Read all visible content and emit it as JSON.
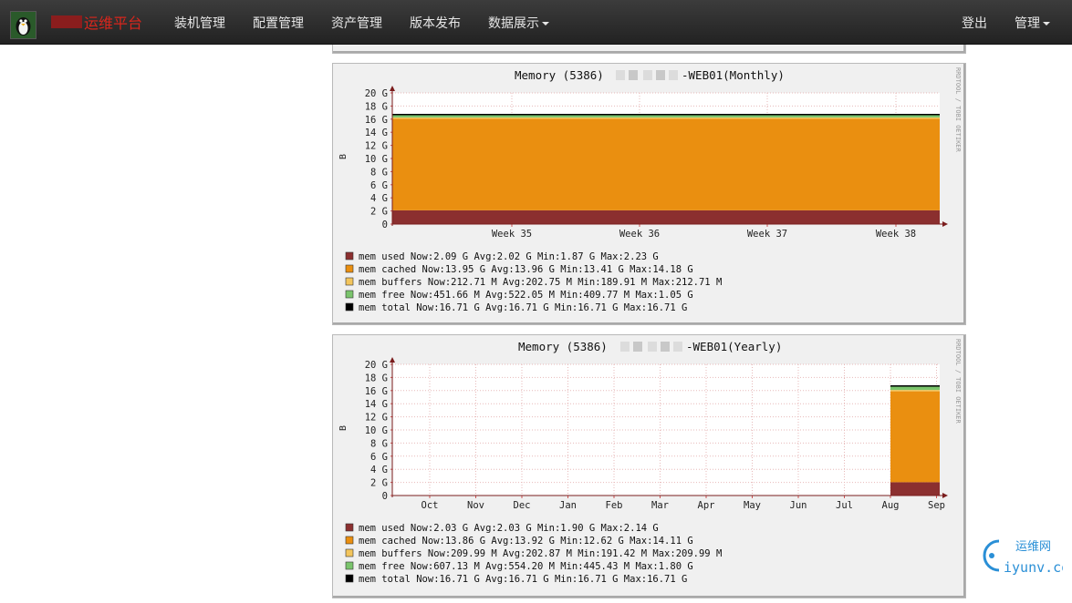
{
  "nav": {
    "brand": "运维平台",
    "items": [
      {
        "label": "装机管理"
      },
      {
        "label": "配置管理"
      },
      {
        "label": "资产管理"
      },
      {
        "label": "版本发布"
      },
      {
        "label": "数据展示",
        "dropdown": true
      }
    ],
    "logout": "登出",
    "admin": "管理",
    "logo_icon": "penguin-avatar-icon",
    "brand_color": "#d9261c"
  },
  "graphs": [
    {
      "title_prefix": "Memory (5386) ",
      "title_suffix": "-WEB01(Monthly)",
      "ylabel": "B",
      "side_text": "RRDTOOL / TOBI OETIKER",
      "yticks": [
        "20 G",
        "18 G",
        "16 G",
        "14 G",
        "12 G",
        "10 G",
        "8 G",
        "6 G",
        "4 G",
        "2 G",
        "0"
      ],
      "xticks": [
        "Week 35",
        "Week 36",
        "Week 37",
        "Week 38"
      ],
      "legend": [
        {
          "color": "#8b2f2f",
          "name": "mem used",
          "stats": "Now:2.09 G   Avg:2.02 G   Min:1.87 G   Max:2.23 G"
        },
        {
          "color": "#ea8f10",
          "name": "mem cached",
          "stats": "Now:13.95 G   Avg:13.96 G   Min:13.41 G   Max:14.18 G"
        },
        {
          "color": "#f3c55c",
          "name": "mem buffers",
          "stats": "Now:212.71 M   Avg:202.75 M   Min:189.91 M   Max:212.71 M"
        },
        {
          "color": "#7ac46c",
          "name": "mem free",
          "stats": "Now:451.66 M   Avg:522.05 M   Min:409.77 M   Max:1.05 G"
        },
        {
          "color": "#000000",
          "name": "mem total",
          "stats": "Now:16.71 G   Avg:16.71 G   Min:16.71 G   Max:16.71 G"
        }
      ]
    },
    {
      "title_prefix": "Memory (5386) ",
      "title_suffix": "-WEB01(Yearly)",
      "ylabel": "B",
      "side_text": "RRDTOOL / TOBI OETIKER",
      "yticks": [
        "20 G",
        "18 G",
        "16 G",
        "14 G",
        "12 G",
        "10 G",
        "8 G",
        "6 G",
        "4 G",
        "2 G",
        "0"
      ],
      "xticks": [
        "Oct",
        "Nov",
        "Dec",
        "Jan",
        "Feb",
        "Mar",
        "Apr",
        "May",
        "Jun",
        "Jul",
        "Aug",
        "Sep"
      ],
      "legend": [
        {
          "color": "#8b2f2f",
          "name": "mem used",
          "stats": "Now:2.03 G   Avg:2.03 G   Min:1.90 G   Max:2.14 G"
        },
        {
          "color": "#ea8f10",
          "name": "mem cached",
          "stats": "Now:13.86 G   Avg:13.92 G   Min:12.62 G   Max:14.11 G"
        },
        {
          "color": "#f3c55c",
          "name": "mem buffers",
          "stats": "Now:209.99 M   Avg:202.87 M   Min:191.42 M   Max:209.99 M"
        },
        {
          "color": "#7ac46c",
          "name": "mem free",
          "stats": "Now:607.13 M   Avg:554.20 M   Min:445.43 M   Max:1.80 G"
        },
        {
          "color": "#000000",
          "name": "mem total",
          "stats": "Now:16.71 G   Avg:16.71 G   Min:16.71 G   Max:16.71 G"
        }
      ]
    }
  ],
  "chart_data": [
    {
      "type": "area",
      "title": "Memory (5386) -WEB01(Monthly)",
      "ylabel": "B",
      "ylim": [
        0,
        20
      ],
      "x": [
        "Week 35",
        "Week 36",
        "Week 37",
        "Week 38"
      ],
      "series": [
        {
          "name": "mem used",
          "values": [
            2.0,
            2.0,
            2.0,
            2.1
          ]
        },
        {
          "name": "mem cached",
          "values": [
            14.0,
            14.0,
            13.9,
            13.95
          ]
        },
        {
          "name": "mem buffers",
          "values": [
            0.2,
            0.2,
            0.2,
            0.21
          ]
        },
        {
          "name": "mem free",
          "values": [
            0.5,
            0.5,
            0.55,
            0.45
          ]
        },
        {
          "name": "mem total",
          "values": [
            16.71,
            16.71,
            16.71,
            16.71
          ]
        }
      ],
      "grid": true
    },
    {
      "type": "area",
      "title": "Memory (5386) -WEB01(Yearly)",
      "ylabel": "B",
      "ylim": [
        0,
        20
      ],
      "x": [
        "Oct",
        "Nov",
        "Dec",
        "Jan",
        "Feb",
        "Mar",
        "Apr",
        "May",
        "Jun",
        "Jul",
        "Aug",
        "Sep"
      ],
      "data_starts_near": "Aug",
      "series": [
        {
          "name": "mem used",
          "values": [
            0,
            0,
            0,
            0,
            0,
            0,
            0,
            0,
            0,
            0,
            2.03,
            2.03
          ]
        },
        {
          "name": "mem cached",
          "values": [
            0,
            0,
            0,
            0,
            0,
            0,
            0,
            0,
            0,
            0,
            13.9,
            13.86
          ]
        },
        {
          "name": "mem buffers",
          "values": [
            0,
            0,
            0,
            0,
            0,
            0,
            0,
            0,
            0,
            0,
            0.2,
            0.21
          ]
        },
        {
          "name": "mem free",
          "values": [
            0,
            0,
            0,
            0,
            0,
            0,
            0,
            0,
            0,
            0,
            0.55,
            0.61
          ]
        },
        {
          "name": "mem total",
          "values": [
            0,
            0,
            0,
            0,
            0,
            0,
            0,
            0,
            0,
            0,
            16.71,
            16.71
          ]
        }
      ],
      "grid": true
    }
  ],
  "watermark": {
    "brand": "运维网",
    "url": "iyunv.com"
  }
}
